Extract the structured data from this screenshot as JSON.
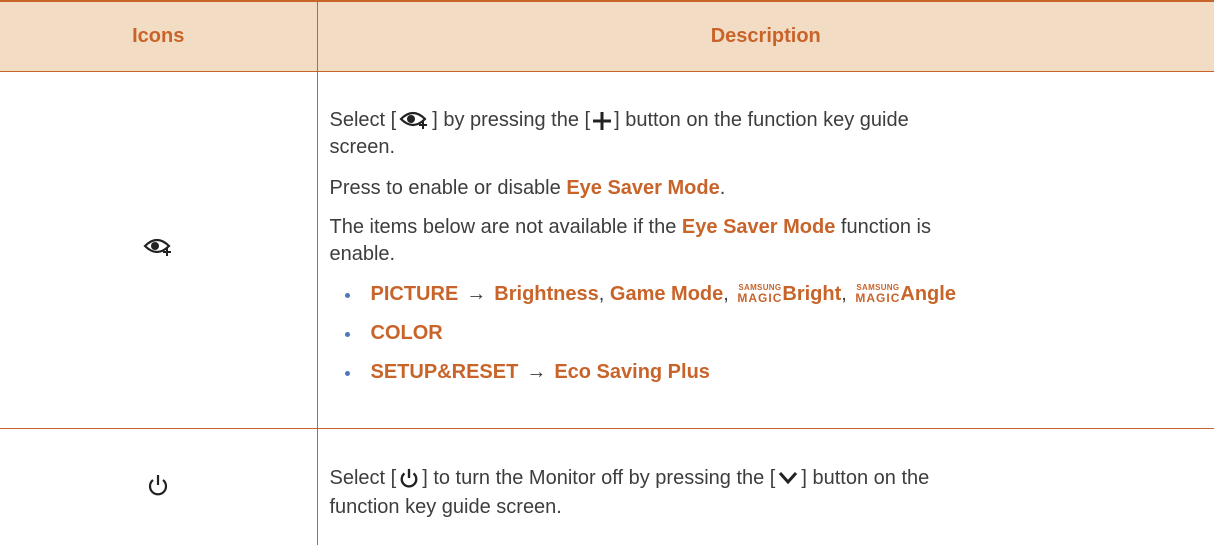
{
  "header": {
    "icons": "Icons",
    "description": "Description"
  },
  "eye_row": {
    "p1_before": "Select [",
    "p1_mid": "] by pressing the [",
    "p1_after": "] button on the function key guide",
    "p1_line2": "screen.",
    "p2_before": "Press to enable or disable ",
    "p2_hl": "Eye Saver Mode",
    "p2_after": ".",
    "p3_before": "The items below are not available if the ",
    "p3_hl": "Eye Saver Mode",
    "p3_after": " function is",
    "p3_line2": "enable.",
    "bullets": {
      "b1": {
        "picture": "PICTURE",
        "arrow": "→",
        "brightness": "Brightness",
        "sep1": ",",
        "game_mode": "Game Mode",
        "sep2": ",",
        "magic_top": "SAMSUNG",
        "magic_bottom": "MAGIC",
        "bright": "Bright",
        "sep3": ",",
        "angle": "Angle"
      },
      "b2": {
        "color": "COLOR"
      },
      "b3": {
        "setup": "SETUP&RESET",
        "arrow": "→",
        "eco": "Eco Saving Plus"
      }
    }
  },
  "power_row": {
    "p1_before": "Select [",
    "p1_mid": "] to turn the Monitor off by pressing the [",
    "p1_after": "] button on the",
    "p1_line2": "function key guide screen."
  },
  "colors": {
    "accent": "#c8642a",
    "header_bg": "#f2dcc4",
    "bullet": "#4e78b8",
    "text": "#3d3d3d"
  },
  "icons": [
    "eye-saver-icon",
    "plus-icon",
    "power-icon",
    "chevron-down-icon"
  ]
}
